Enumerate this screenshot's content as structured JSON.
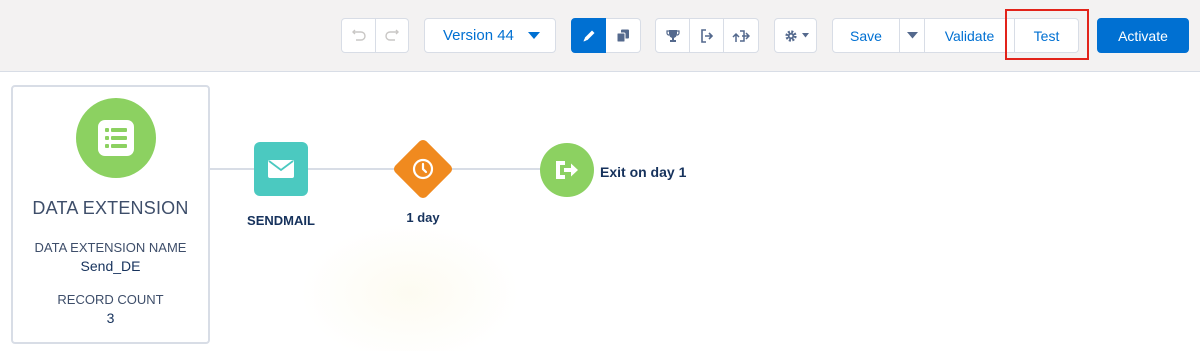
{
  "toolbar": {
    "undo_icon": "undo-icon",
    "redo_icon": "redo-icon",
    "version_label": "Version 44",
    "edit_icon": "pencil-icon",
    "copy_icon": "copy-icon",
    "goal_icon": "trophy-icon",
    "exit_criteria_icon": "exit-icon",
    "export_icon": "export-icon",
    "settings_icon": "gear-icon",
    "save_label": "Save",
    "validate_label": "Validate",
    "test_label": "Test",
    "activate_label": "Activate",
    "highlight_color": "#e2231a",
    "primary_color": "#0070d2"
  },
  "canvas": {
    "source": {
      "icon": "list-icon",
      "title": "DATA EXTENSION",
      "name_label": "DATA EXTENSION NAME",
      "name_value": "Send_DE",
      "count_label": "RECORD COUNT",
      "count_value": "3",
      "color": "#8cd161"
    },
    "nodes": [
      {
        "type": "email",
        "icon": "envelope-icon",
        "label": "SENDMAIL",
        "color": "#4bc9c0"
      },
      {
        "type": "wait",
        "icon": "clock-icon",
        "label": "1 day",
        "color": "#f08a1f"
      },
      {
        "type": "exit",
        "icon": "exit-icon",
        "label": "Exit on day 1",
        "color": "#8cd161"
      }
    ]
  }
}
